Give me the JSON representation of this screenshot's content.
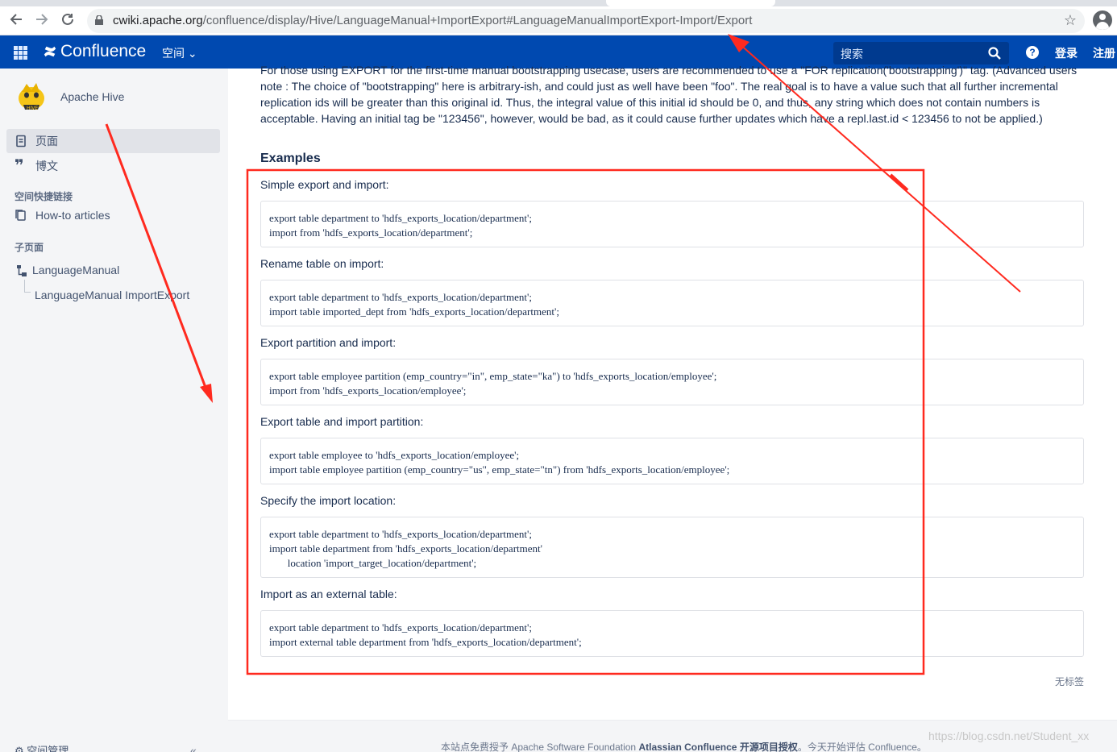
{
  "browser": {
    "url_host": "cwiki.apache.org",
    "url_path": "/confluence/display/Hive/LanguageManual+ImportExport#LanguageManualImportExport-Import/Export"
  },
  "header": {
    "brand": "Confluence",
    "spaces_menu": "空间",
    "search_placeholder": "搜索",
    "help": "?",
    "login": "登录",
    "signup": "注册"
  },
  "sidebar": {
    "space_name": "Apache Hive",
    "pages": "页面",
    "blog": "博文",
    "shortcuts_heading": "空间快捷链接",
    "howto": "How-to articles",
    "children_heading": "子页面",
    "tree_parent": "LanguageManual",
    "tree_child": "LanguageManual ImportExport",
    "space_admin": "空间管理"
  },
  "main": {
    "intro": "For those using EXPORT for the first-time manual bootstrapping usecase, users are recommended to use a \"FOR replication('bootstrapping')\" tag. (Advanced users note : The choice of \"bootstrapping\" here is arbitrary-ish, and could just as well have been \"foo\". The real goal is to have a value such that all further incremental replication ids will be greater than this original id. Thus, the integral value of this initial id should be 0, and thus, any string which does not contain numbers is acceptable. Having an initial tag be \"123456\", however, would be bad, as it could cause further updates which have a repl.last.id < 123456 to not be applied.)",
    "examples_heading": "Examples",
    "examples": [
      {
        "label": "Simple export and import:",
        "code": "export table department to 'hdfs_exports_location/department';\nimport from 'hdfs_exports_location/department';"
      },
      {
        "label": "Rename table on import:",
        "code": "export table department to 'hdfs_exports_location/department';\nimport table imported_dept from 'hdfs_exports_location/department';"
      },
      {
        "label": "Export partition and import:",
        "code": "export table employee partition (emp_country=\"in\", emp_state=\"ka\") to 'hdfs_exports_location/employee';\nimport from 'hdfs_exports_location/employee';"
      },
      {
        "label": "Export table and import partition:",
        "code": "export table employee to 'hdfs_exports_location/employee';\nimport table employee partition (emp_country=\"us\", emp_state=\"tn\") from 'hdfs_exports_location/employee';"
      },
      {
        "label": "Specify the import location:",
        "code": "export table department to 'hdfs_exports_location/department';\nimport table department from 'hdfs_exports_location/department'\n       location 'import_target_location/department';"
      },
      {
        "label": "Import as an external table:",
        "code": "export table department to 'hdfs_exports_location/department';\nimport external table department from 'hdfs_exports_location/department';"
      }
    ],
    "no_labels": "无标签"
  },
  "footer": {
    "text_prefix": "本站点免费授予 Apache Software Foundation ",
    "text_bold": "Atlassian Confluence 开源项目授权",
    "text_suffix": "。今天开始评估 Confluence。"
  },
  "watermark": "https://blog.csdn.net/Student_xx",
  "colors": {
    "header_bg": "#0049b0",
    "annotation_red": "#ff2a1f"
  }
}
